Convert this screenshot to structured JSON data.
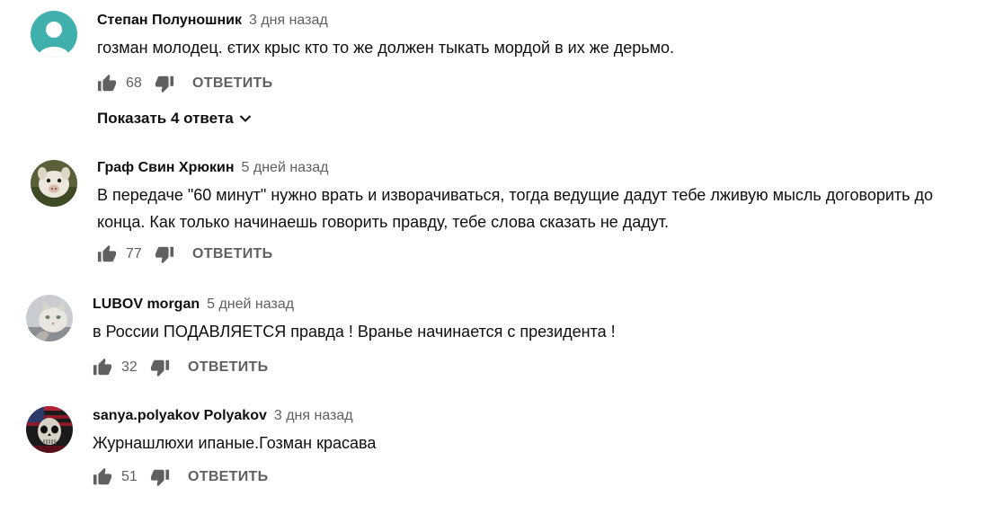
{
  "comments": [
    {
      "author": "Степан Полуношник",
      "date": "3 дня назад",
      "text": "гозман молодец. єтих крыс кто то же должен тыкать мордой в их же дерьмо.",
      "likes": "68",
      "reply_label": "ОТВЕТИТЬ",
      "avatar": "default-person-avatar",
      "show_replies_label": "Показать 4 ответа"
    },
    {
      "author": "Граф Свин Хрюкин",
      "date": "5 дней назад",
      "text": "В передаче \"60 минут\" нужно врать и изворачиваться, тогда ведущие дадут тебе лживую мысль договорить до конца. Как только начинаешь говорить правду, тебе слова сказать не дадут.",
      "likes": "77",
      "reply_label": "ОТВЕТИТЬ",
      "avatar": "pig-avatar"
    },
    {
      "author": "LUBOV morgan",
      "date": "5 дней назад",
      "text": "в России ПОДАВЛЯЕТСЯ правда ! Вранье начинается с президента !",
      "likes": "32",
      "reply_label": "ОТВЕТИТЬ",
      "avatar": "cat-avatar"
    },
    {
      "author": "sanya.polyakov Polyakov",
      "date": "3 дня назад",
      "text": "Журнашлюхи ипаные.Гозман красава",
      "likes": "51",
      "reply_label": "ОТВЕТИТЬ",
      "avatar": "skull-flag-avatar"
    }
  ],
  "icons": {
    "like": "thumb-up-icon",
    "dislike": "thumb-down-icon",
    "expand": "chevron-down-icon"
  },
  "colors": {
    "text": "#0f0f0f",
    "secondary": "#606060",
    "default_avatar": "#3fb0ac"
  }
}
